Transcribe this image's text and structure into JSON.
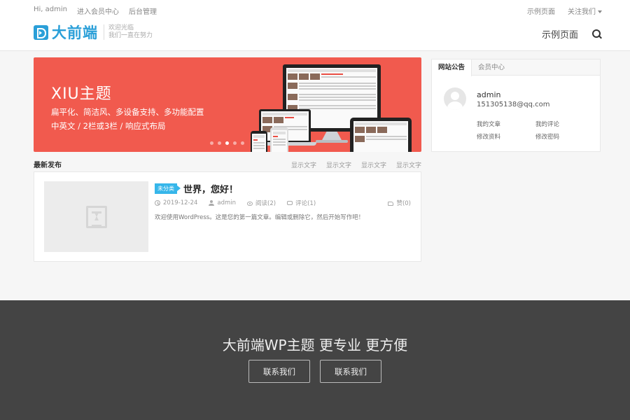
{
  "topbar": {
    "greeting": "Hi, admin",
    "member_center": "进入会员中心",
    "admin_panel": "后台管理",
    "example_page": "示例页面",
    "follow_us": "关注我们"
  },
  "header": {
    "logo_text": "大前端",
    "slogan_line1": "欢迎光临",
    "slogan_line2": "我们一直在努力",
    "nav_example": "示例页面",
    "accent_color": "#2a9fd8"
  },
  "banner": {
    "title": "XIU主题",
    "line1": "扁平化、简洁风、多设备支持、多功能配置",
    "line2": "中英文 / 2栏或3栏 / 响应式布局",
    "background": "#f15a4e",
    "slide_count": 5,
    "active_slide": 3
  },
  "latest": {
    "title": "最新发布",
    "links": [
      "显示文字",
      "显示文字",
      "显示文字",
      "显示文字"
    ]
  },
  "post": {
    "category": "未分类",
    "title": "世界，您好！",
    "date": "2019-12-24",
    "author": "admin",
    "views": "阅读(2)",
    "comments": "评论(1)",
    "likes": "赞(0)",
    "excerpt": "欢迎使用WordPress。这是您的第一篇文章。编辑或删除它，然后开始写作吧！"
  },
  "widget": {
    "tab_notice": "网站公告",
    "tab_member": "会员中心",
    "username": "admin",
    "email": "151305138@qq.com",
    "links": [
      "我的文章",
      "我的评论",
      "修改资料",
      "修改密码"
    ]
  },
  "footer": {
    "title": "大前端WP主题 更专业 更方便",
    "button1": "联系我们",
    "button2": "联系我们",
    "background": "#444444"
  }
}
